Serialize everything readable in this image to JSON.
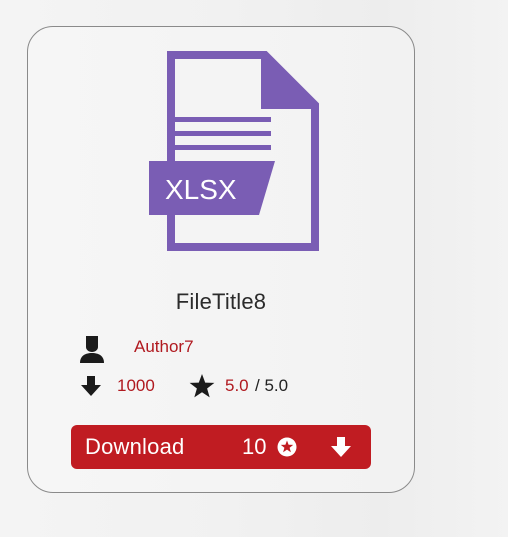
{
  "file": {
    "type_label": "XLSX",
    "title": "FileTitle8",
    "accent_color": "#7a5db4"
  },
  "author": {
    "name": "Author7"
  },
  "stats": {
    "downloads": "1000",
    "rating": "5.0",
    "rating_max": "/ 5.0"
  },
  "download_button": {
    "label": "Download",
    "cost": "10",
    "color": "#c01c22"
  },
  "icons": {
    "file": "xlsx-file-icon",
    "author": "user-icon",
    "downloads": "download-arrow-icon",
    "rating": "star-icon",
    "cost": "coin-star-icon",
    "button": "download-arrow-icon"
  }
}
